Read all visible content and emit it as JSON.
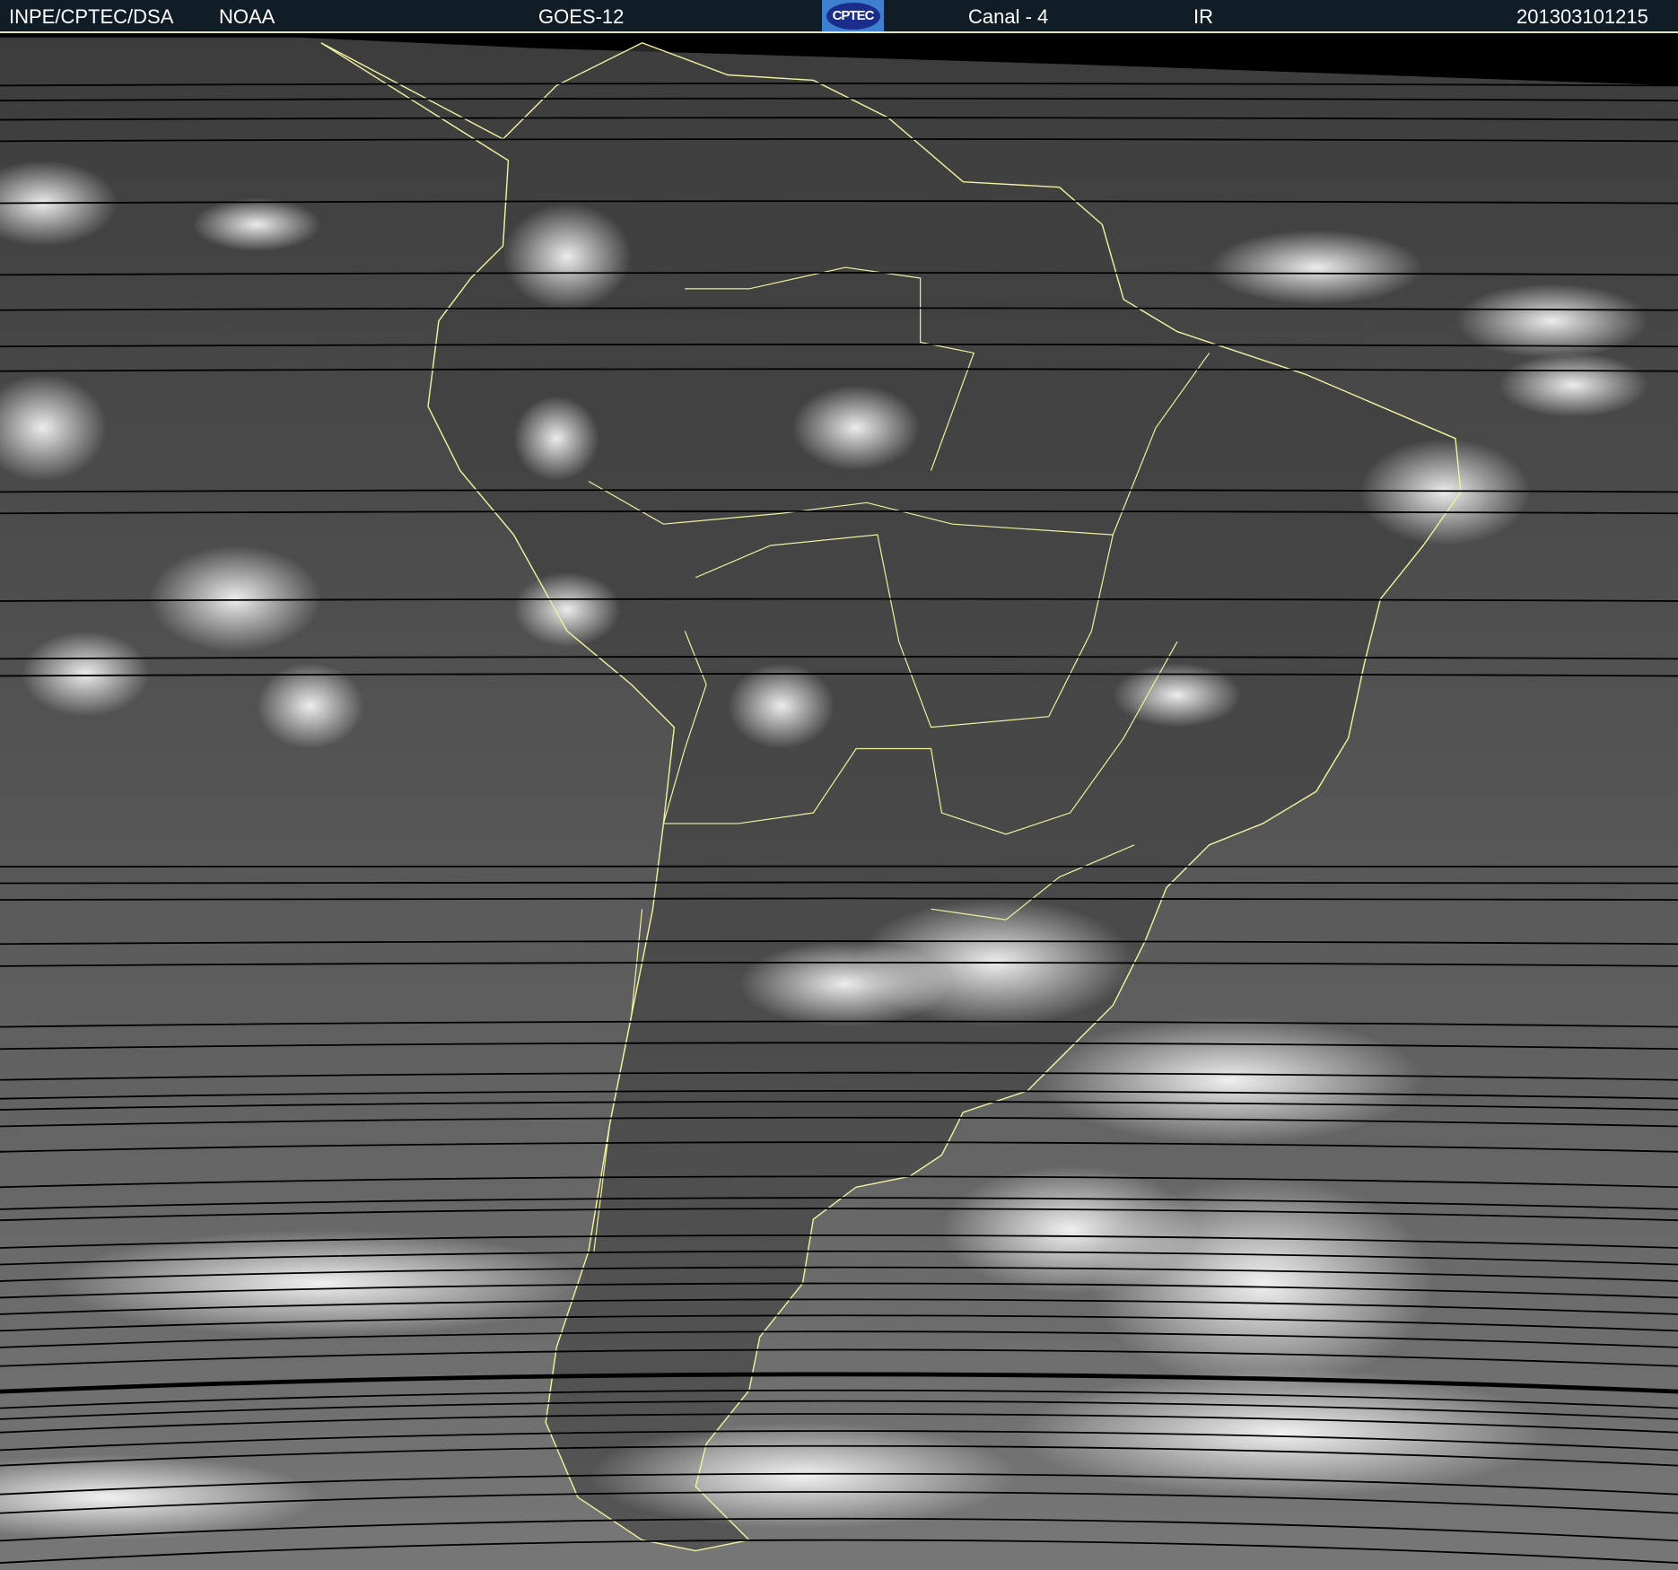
{
  "header": {
    "agency": "INPE/CPTEC/DSA",
    "source": "NOAA",
    "satellite": "GOES-12",
    "logo_text": "CPTEC",
    "channel": "Canal - 4",
    "band": "IR",
    "timestamp": "201303101215"
  },
  "colors": {
    "header_bg": "#111d26",
    "coastline": "#f0f0a0",
    "scanline": "#000000"
  }
}
